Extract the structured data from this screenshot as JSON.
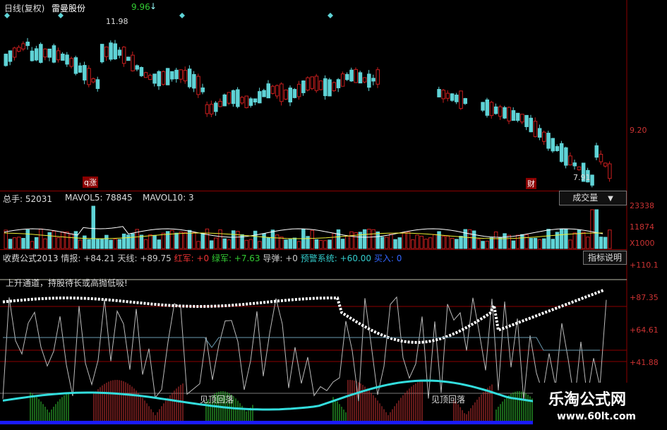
{
  "top_header": {
    "chart_mode": "日线(复权)",
    "stock_name": "雷曼股份",
    "peak_label": "9.96"
  },
  "price_panel": {
    "high_label": "11.98",
    "low_label": "7.91",
    "axis_label": "9.20",
    "marker_left": "q涨",
    "marker_right": "财"
  },
  "volume_header": {
    "total_label": "总手: 52031",
    "mavol5_label": "MAVOL5: 78845",
    "mavol10_label": "MAVOL10: 3",
    "dropdown_label": "成交量"
  },
  "volume_axis": [
    "23338",
    "11874",
    "X1000"
  ],
  "indicator_header": {
    "title": "收费公式2013",
    "items": [
      {
        "label": "情报: +84.21",
        "color": "#ccc"
      },
      {
        "label": "天线: +89.75",
        "color": "#ccc"
      },
      {
        "label": "红军: +0",
        "color": "#e33"
      },
      {
        "label": "绿军: +7.63",
        "color": "#3c3"
      },
      {
        "label": "导弹: +0",
        "color": "#ccc"
      },
      {
        "label": "预警系统: +60.00",
        "color": "#3cc"
      },
      {
        "label": "买入: 0",
        "color": "#36f"
      }
    ],
    "explain_button": "指标说明"
  },
  "indicator_axis": [
    "+110.1",
    "+87.35",
    "+64.61",
    "+41.88"
  ],
  "indicator_notes": {
    "trend_note": "上升通道，持股待长或高抛低吸!",
    "callback_left": "见顶回落",
    "callback_right": "见顶回落"
  },
  "watermark": {
    "title": "乐淘公式网",
    "url": "www.60lt.com"
  },
  "colors": {
    "up": "#c81e1e",
    "down": "#5fd3d6",
    "accent": "#e33",
    "grid": "#8b0000"
  }
}
